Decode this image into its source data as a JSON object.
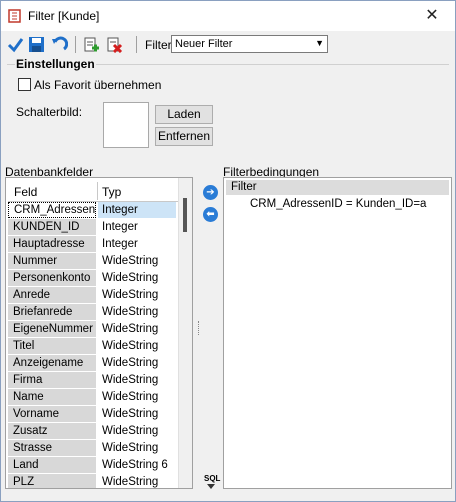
{
  "window": {
    "title": "Filter  [Kunde]",
    "close_glyph": "✕"
  },
  "toolbar": {
    "icons": [
      "check-icon",
      "save-icon",
      "undo-icon",
      "new-filter-icon",
      "delete-filter-icon"
    ],
    "filter_label": "Filter",
    "filter_value": "Neuer Filter"
  },
  "settings": {
    "group_title": "Einstellungen",
    "favorite_label": "Als Favorit übernehmen",
    "favorite_checked": false,
    "button_image_label": "Schalterbild:",
    "load_button": "Laden",
    "remove_button": "Entfernen"
  },
  "fields_panel": {
    "title": "Datenbankfelder",
    "columns": [
      "Feld",
      "Typ"
    ],
    "rows": [
      {
        "field": "CRM_AdressenID",
        "type": "Integer",
        "selected": true
      },
      {
        "field": "KUNDEN_ID",
        "type": "Integer"
      },
      {
        "field": "Hauptadresse",
        "type": "Integer"
      },
      {
        "field": "Nummer",
        "type": "WideString"
      },
      {
        "field": "Personenkonto",
        "type": "WideString"
      },
      {
        "field": "Anrede",
        "type": "WideString"
      },
      {
        "field": "Briefanrede",
        "type": "WideString"
      },
      {
        "field": "EigeneNummer",
        "type": "WideString"
      },
      {
        "field": "Titel",
        "type": "WideString"
      },
      {
        "field": "Anzeigename",
        "type": "WideString"
      },
      {
        "field": "Firma",
        "type": "WideString"
      },
      {
        "field": "Name",
        "type": "WideString"
      },
      {
        "field": "Vorname",
        "type": "WideString"
      },
      {
        "field": "Zusatz",
        "type": "WideString"
      },
      {
        "field": "Strasse",
        "type": "WideString"
      },
      {
        "field": "Land",
        "type": "WideString 6"
      },
      {
        "field": "PLZ",
        "type": "WideString"
      }
    ]
  },
  "conditions_panel": {
    "title": "Filterbedingungen",
    "root": "Filter",
    "condition": "CRM_AdressenID = Kunden_ID=a"
  },
  "sql_label": "SQL",
  "colors": {
    "accent": "#2a7cd6",
    "selection": "#cde4f7"
  }
}
